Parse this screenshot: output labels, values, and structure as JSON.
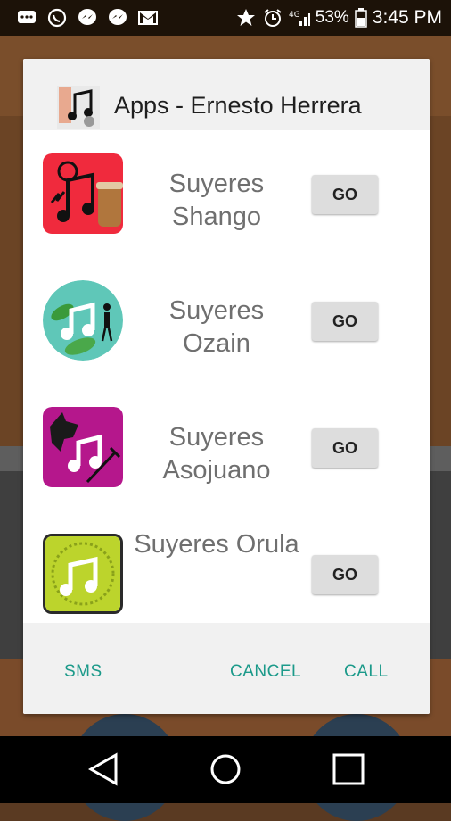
{
  "status_bar": {
    "battery": "53%",
    "time": "3:45 PM",
    "left_icons": [
      "chat-bubble-icon",
      "whatsapp-icon",
      "messenger-icon",
      "messenger-icon",
      "gmail-icon"
    ],
    "right_icons": [
      "star-icon",
      "alarm-icon",
      "signal-icon",
      "battery-icon"
    ]
  },
  "dialog": {
    "title": "Apps - Ernesto Herrera",
    "apps": [
      {
        "name_line1": "Suyeres",
        "name_line2": "Shango",
        "button": "GO",
        "icon": "shango-drum-icon"
      },
      {
        "name_line1": "Suyeres",
        "name_line2": "Ozain",
        "button": "GO",
        "icon": "ozain-leaf-icon"
      },
      {
        "name_line1": "Suyeres",
        "name_line2": "Asojuano",
        "button": "GO",
        "icon": "asojuano-dog-icon"
      },
      {
        "name_line1": "Suyeres Orula",
        "name_line2": "",
        "button": "GO",
        "icon": "orula-icon"
      }
    ],
    "footer": {
      "sms": "SMS",
      "cancel": "CANCEL",
      "call": "CALL"
    }
  },
  "colors": {
    "accent": "#1c9a8a",
    "dialog_bg": "#ffffff",
    "title_bg": "#f1f1f1"
  },
  "nav_bar": [
    "back-icon",
    "home-icon",
    "recents-icon"
  ]
}
